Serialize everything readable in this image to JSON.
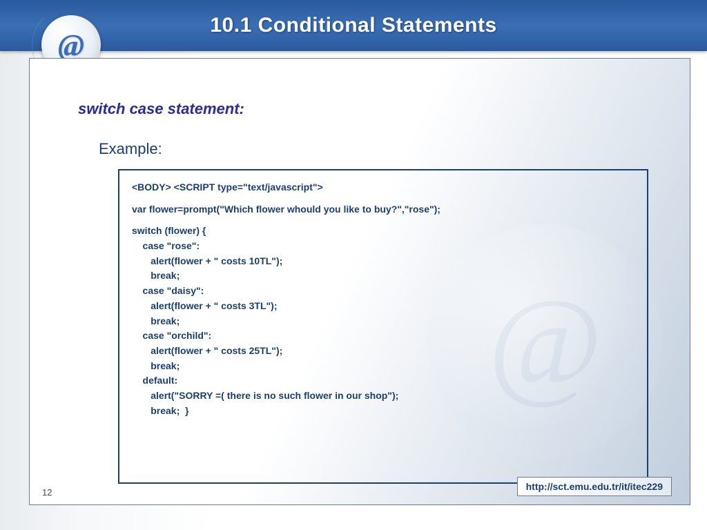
{
  "title": "10.1  Conditional Statements",
  "logo_glyph": "@",
  "subtitle": "switch case statement:",
  "example_label": "Example:",
  "code_lines": [
    "<BODY> <SCRIPT type=\"text/javascript\">",
    "",
    "var flower=prompt(\"Which flower whould you like to buy?\",\"rose\");",
    "",
    "switch (flower) {",
    "    case \"rose\":",
    "       alert(flower + \" costs 10TL\");",
    "       break;",
    "    case \"daisy\":",
    "       alert(flower + \" costs 3TL\");",
    "       break;",
    "    case \"orchild\":",
    "       alert(flower + \" costs 25TL\");",
    "       break;",
    "    default:",
    "       alert(\"SORRY =( there is no such flower in our shop\");",
    "       break;  }"
  ],
  "page_number": "12",
  "footer_url": "http://sct.emu.edu.tr/it/itec229"
}
